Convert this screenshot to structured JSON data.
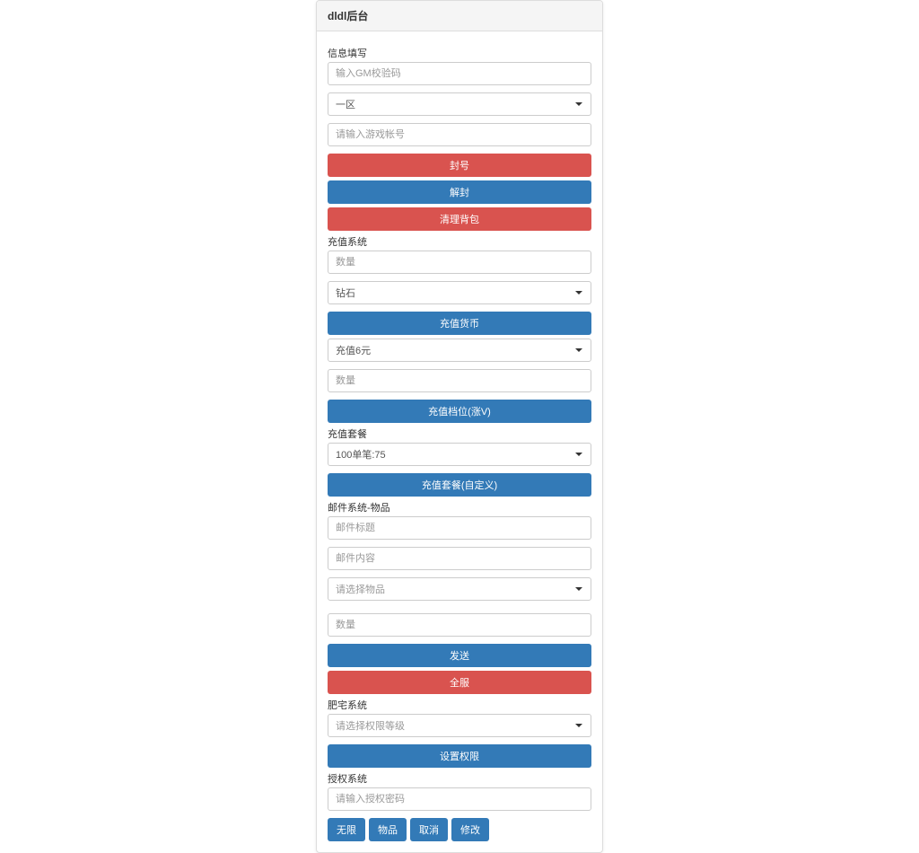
{
  "header": {
    "title": "dldl后台"
  },
  "info": {
    "section_label": "信息填写",
    "gm_placeholder": "输入GM校验码",
    "zone_selected": "一区",
    "account_placeholder": "请输入游戏帐号",
    "btn_ban": "封号",
    "btn_unban": "解封",
    "btn_clearbag": "清理背包"
  },
  "recharge": {
    "section_label": "充值系统",
    "qty_placeholder": "数量",
    "currency_selected": "钻石",
    "btn_currency": "充值货币",
    "tier_selected": "充值6元",
    "qty2_placeholder": "数量",
    "btn_rank": "充值档位(涨V)"
  },
  "package": {
    "section_label": "充值套餐",
    "selected": "100单笔:75",
    "btn_package": "充值套餐(自定义)"
  },
  "mail": {
    "section_label": "邮件系统-物品",
    "title_placeholder": "邮件标题",
    "content_placeholder": "邮件内容",
    "item_selected": "请选择物品",
    "qty_placeholder": "数量",
    "btn_send": "发送",
    "btn_all": "全服"
  },
  "perm": {
    "section_label": "肥宅系统",
    "level_selected": "请选择权限等级",
    "btn_setperm": "设置权限"
  },
  "auth": {
    "section_label": "授权系统",
    "code_placeholder": "请输入授权密码",
    "btn_unlimited": "无限",
    "btn_goods": "物品",
    "btn_cancel": "取消",
    "btn_modify": "修改"
  }
}
